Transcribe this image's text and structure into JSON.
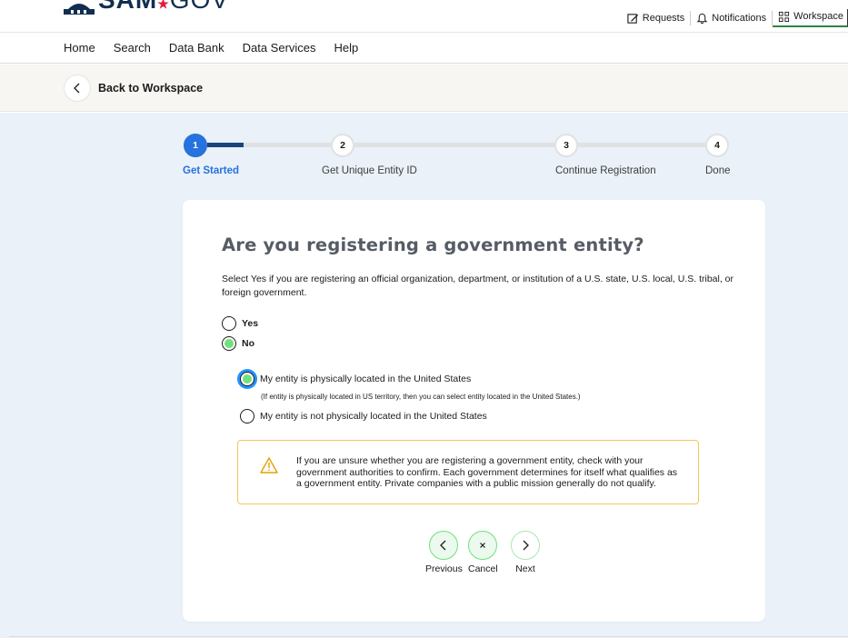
{
  "header": {
    "logo_main": "SAM",
    "logo_star": "★",
    "logo_suffix": "GOV",
    "utility": [
      {
        "label": "Requests"
      },
      {
        "label": "Notifications"
      },
      {
        "label": "Workspace"
      }
    ]
  },
  "nav": {
    "items": [
      "Home",
      "Search",
      "Data Bank",
      "Data Services",
      "Help"
    ]
  },
  "back": {
    "label": "Back to Workspace"
  },
  "stepper": {
    "steps": [
      {
        "number": "1",
        "label": "Get Started",
        "active": true
      },
      {
        "number": "2",
        "label": "Get Unique Entity ID"
      },
      {
        "number": "3",
        "label": "Continue Registration"
      },
      {
        "number": "4",
        "label": "Done"
      }
    ]
  },
  "form": {
    "title": "Are you registering a government entity?",
    "description": "Select Yes if you are registering an official organization, department, or institution of a U.S. state, U.S. local, U.S. tribal, or foreign government.",
    "yes_label": "Yes",
    "no_label": "No",
    "selected": "No",
    "sub_option_1": "My entity is physically located in the United States",
    "sub_note": "(If entity is physically located in US territory, then you can select entity located in the United States.)",
    "sub_option_2": "My entity is not physically located in the United States",
    "sub_selected": "My entity is physically located in the United States",
    "alert_text": "If you are unsure whether you are registering a government entity, check with your government authorities to confirm. Each government determines for itself what qualifies as a government entity. Private companies with a public mission generally do not qualify."
  },
  "actions": {
    "previous": "Previous",
    "cancel": "Cancel",
    "next": "Next"
  },
  "colors": {
    "active_step": "#2672de",
    "radio_checked": "#70e17b",
    "alert_border": "#f1c55f",
    "main_bg": "#eaf1f8"
  }
}
